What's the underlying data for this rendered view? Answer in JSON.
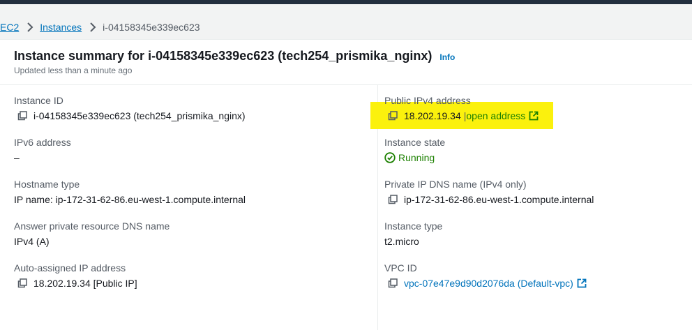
{
  "breadcrumb": {
    "root": "EC2",
    "instances": "Instances",
    "current": "i-04158345e339ec623"
  },
  "summary": {
    "title": "Instance summary for i-04158345e339ec623 (tech254_prismika_nginx)",
    "info": "Info",
    "updated": "Updated less than a minute ago"
  },
  "left": {
    "instance_id_label": "Instance ID",
    "instance_id_value": "i-04158345e339ec623 (tech254_prismika_nginx)",
    "ipv6_label": "IPv6 address",
    "ipv6_value": "–",
    "hostname_type_label": "Hostname type",
    "hostname_type_value": "IP name: ip-172-31-62-86.eu-west-1.compute.internal",
    "dns_label": "Answer private resource DNS name",
    "dns_value": "IPv4 (A)",
    "auto_ip_label": "Auto-assigned IP address",
    "auto_ip_value": "18.202.19.34 [Public IP]"
  },
  "right": {
    "public_ip_label": "Public IPv4 address",
    "public_ip_value": "18.202.19.34",
    "public_ip_sep": "|",
    "open_address": "open address",
    "state_label": "Instance state",
    "state_value": "Running",
    "private_dns_label": "Private IP DNS name (IPv4 only)",
    "private_dns_value": "ip-172-31-62-86.eu-west-1.compute.internal",
    "type_label": "Instance type",
    "type_value": "t2.micro",
    "vpc_label": "VPC ID",
    "vpc_value": "vpc-07e47e9d90d2076da (Default-vpc)"
  },
  "colors": {
    "link": "#0073bb",
    "success": "#1d8102",
    "highlight": "#fbf10d",
    "header_bar": "#232f3e"
  },
  "icons": [
    "chevron-right-icon",
    "copy-icon",
    "external-link-icon",
    "check-circle-icon"
  ]
}
